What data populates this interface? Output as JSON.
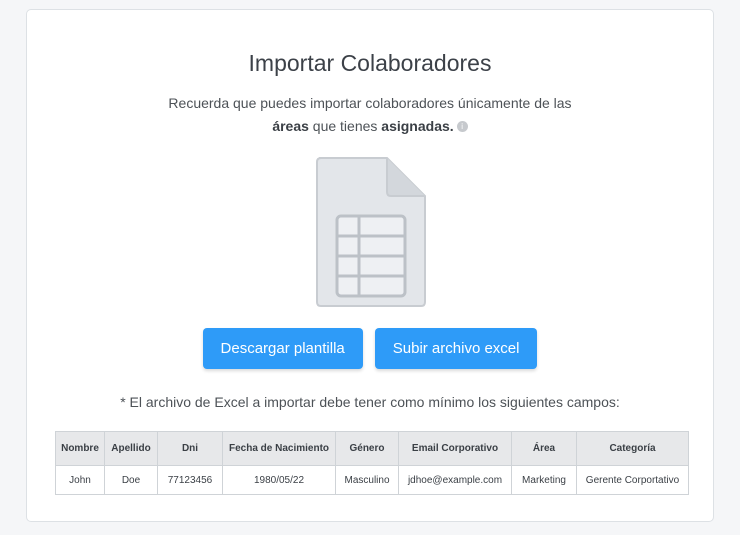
{
  "header": {
    "title": "Importar Colaboradores",
    "subtitle_line1": "Recuerda que puedes importar colaboradores únicamente de las",
    "subtitle_bold1": "áreas",
    "subtitle_mid": " que tienes ",
    "subtitle_bold2": "asignadas.",
    "info_icon_glyph": "i"
  },
  "actions": {
    "download_label": "Descargar plantilla",
    "upload_label": "Subir archivo excel",
    "accent_color": "#2e9bf8"
  },
  "note": "* El archivo de Excel a importar debe tener como mínimo los siguientes campos:",
  "table": {
    "headers": [
      "Nombre",
      "Apellido",
      "Dni",
      "Fecha de Nacimiento",
      "Género",
      "Email Corporativo",
      "Área",
      "Categoría"
    ],
    "row": [
      "John",
      "Doe",
      "77123456",
      "1980/05/22",
      "Masculino",
      "jdhoe@example.com",
      "Marketing",
      "Gerente Corportativo"
    ]
  }
}
